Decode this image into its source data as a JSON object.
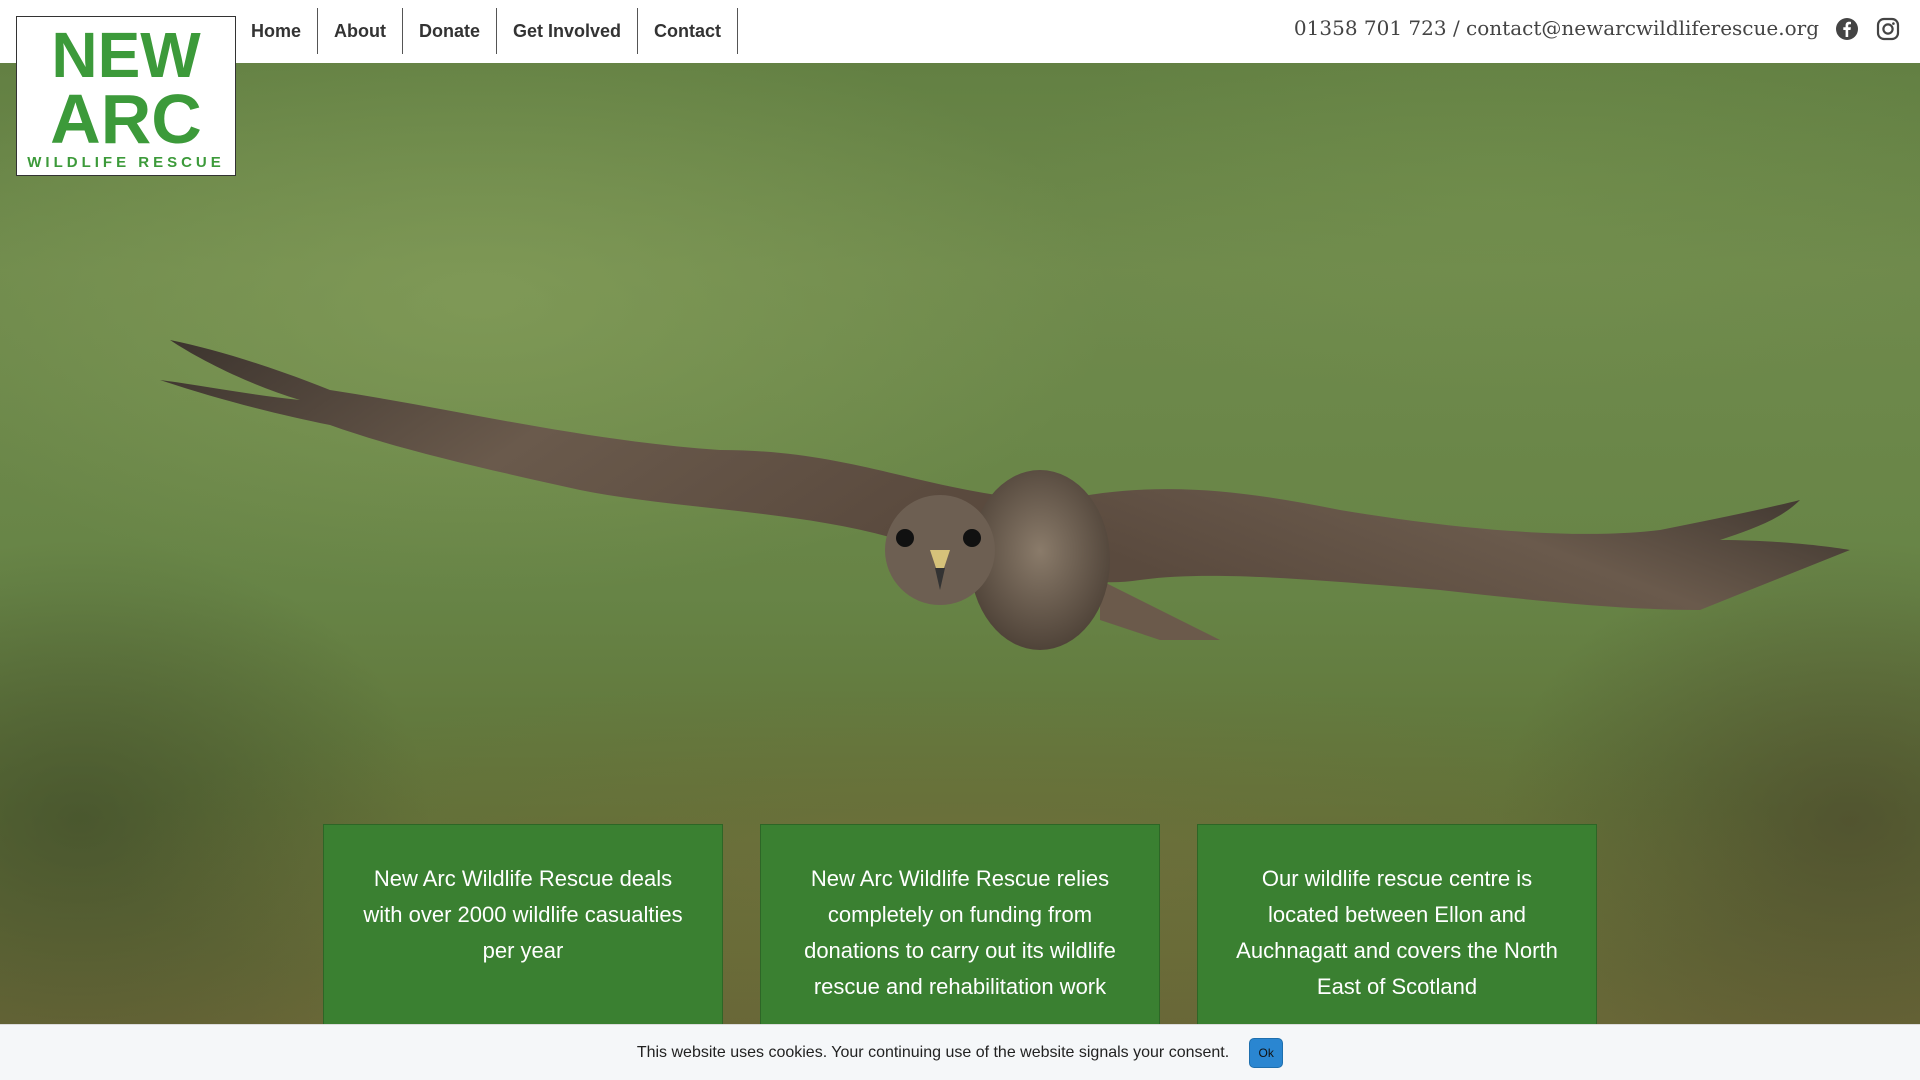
{
  "brand": {
    "logo_word1": "NEW",
    "logo_word2": "ARC",
    "logo_tagline": "WILDLIFE RESCUE",
    "logo_color": "#3c9a3a"
  },
  "nav": {
    "items": [
      {
        "label": "Home"
      },
      {
        "label": "About"
      },
      {
        "label": "Donate"
      },
      {
        "label": "Get Involved"
      },
      {
        "label": "Contact"
      }
    ]
  },
  "contact": {
    "text": "01358 701 723 / contact@newarcwildliferescue.org"
  },
  "social": {
    "facebook_icon": "facebook-icon",
    "instagram_icon": "instagram-icon"
  },
  "cards": [
    {
      "text": "New Arc Wildlife Rescue deals with over 2000 wildlife casualties per year"
    },
    {
      "text": "New Arc Wildlife Rescue relies completely on funding from donations to carry out its wildlife rescue and rehabilitation work"
    },
    {
      "text": "Our wildlife rescue centre is located between Ellon and Auchnagatt and covers the North East of Scotland"
    }
  ],
  "cookie": {
    "message": "This website uses cookies. Your continuing use of the website signals your consent.",
    "ok_label": "Ok"
  },
  "colors": {
    "card_green": "#3a8031",
    "accent_blue": "#2a86d1"
  }
}
